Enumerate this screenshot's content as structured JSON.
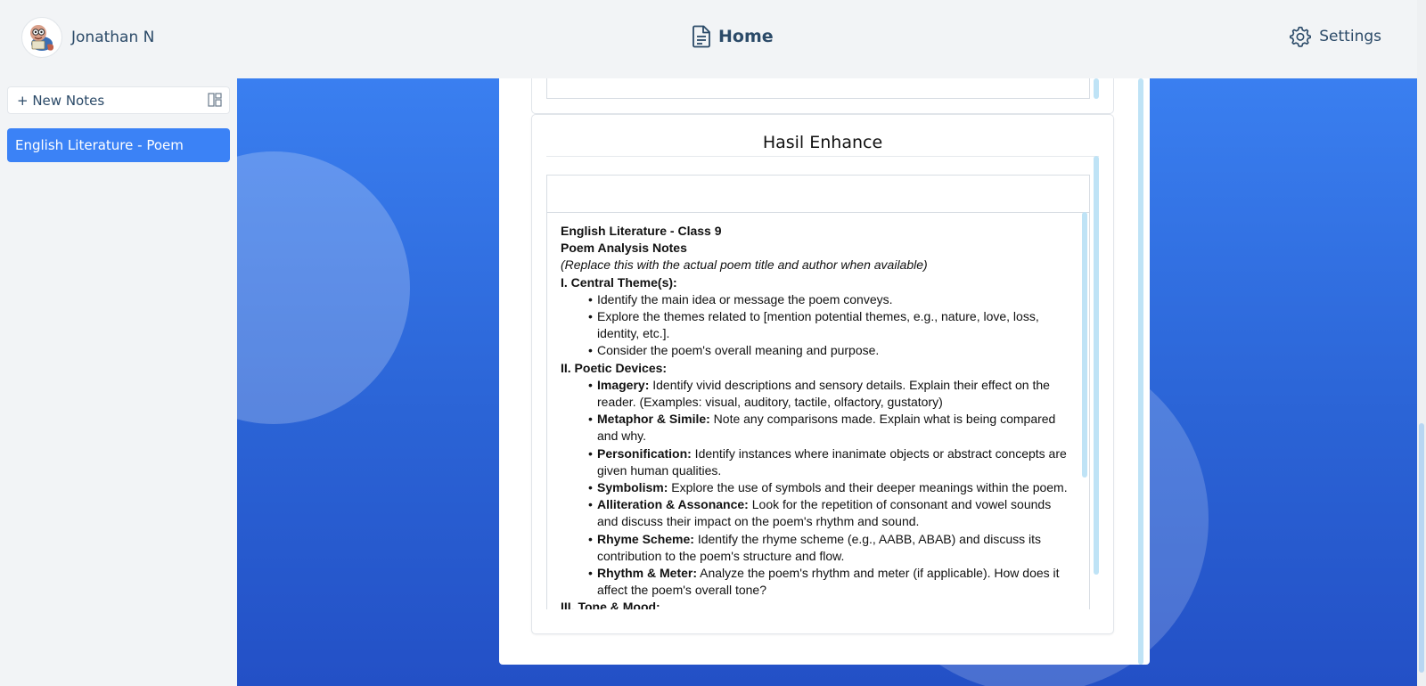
{
  "header": {
    "username": "Jonathan N",
    "home_label": "Home",
    "settings_label": "Settings"
  },
  "sidebar": {
    "new_note_label": "+ New Notes",
    "notes": [
      {
        "label": "English Literature - Poem",
        "selected": true
      }
    ]
  },
  "card": {
    "title": "Hasil Enhance"
  },
  "document": {
    "line1": "English Literature - Class 9",
    "line2": "Poem Analysis Notes",
    "line3": "(Replace this with the actual poem title and author when available)",
    "section1": {
      "heading": "I. Central Theme(s):",
      "items": [
        "Identify the main idea or message the poem conveys.",
        "Explore the themes related to [mention potential themes, e.g., nature, love, loss, identity, etc.].",
        "Consider the poem's overall meaning and purpose."
      ]
    },
    "section2": {
      "heading": "II. Poetic Devices:",
      "items": [
        {
          "term": "Imagery:",
          "text": " Identify vivid descriptions and sensory details. Explain their effect on the reader. (Examples: visual, auditory, tactile, olfactory, gustatory)"
        },
        {
          "term": "Metaphor & Simile:",
          "text": " Note any comparisons made. Explain what is being compared and why."
        },
        {
          "term": "Personification:",
          "text": " Identify instances where inanimate objects or abstract concepts are given human qualities."
        },
        {
          "term": "Symbolism:",
          "text": " Explore the use of symbols and their deeper meanings within the poem."
        },
        {
          "term": "Alliteration & Assonance:",
          "text": " Look for the repetition of consonant and vowel sounds and discuss their impact on the poem's rhythm and sound."
        },
        {
          "term": "Rhyme Scheme:",
          "text": " Identify the rhyme scheme (e.g., AABB, ABAB) and discuss its contribution to the poem's structure and flow."
        },
        {
          "term": "Rhythm & Meter:",
          "text": " Analyze the poem's rhythm and meter (if applicable). How does it affect the poem's overall tone?"
        }
      ]
    },
    "section3": {
      "heading": "III. Tone & Mood:"
    }
  },
  "icons": {
    "header_center": "document-icon",
    "header_right": "gear-icon",
    "sidebar_toggle": "layout-icon"
  },
  "colors": {
    "accent": "#3b82f6",
    "header_text": "#2b4a68",
    "background_gradient_top": "#3a7ff0",
    "background_gradient_bottom": "#2350c6",
    "scrollbar": "#bfe3f6"
  }
}
